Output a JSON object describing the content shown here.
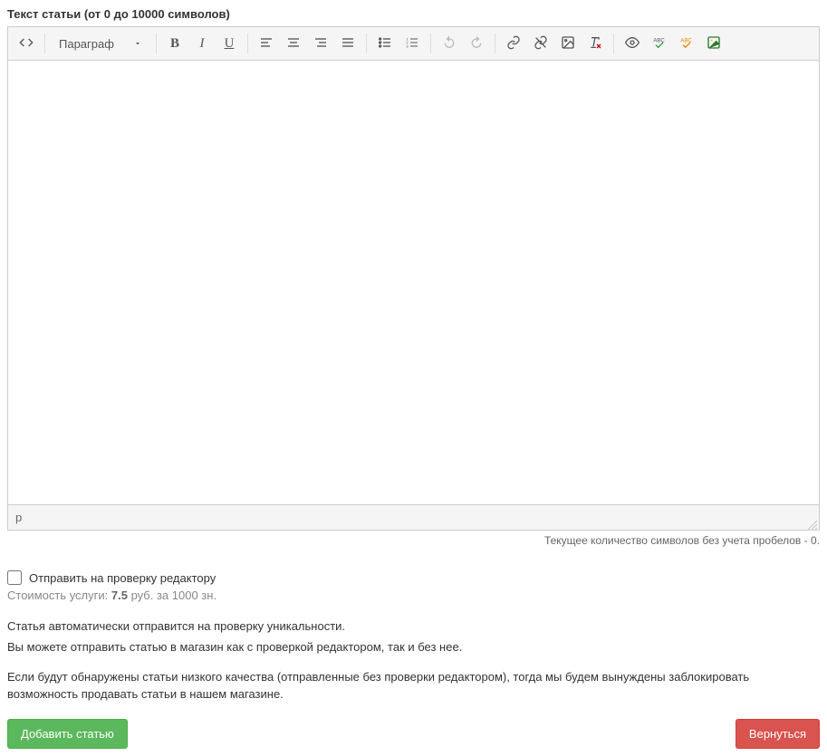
{
  "label": "Текст статьи (от 0 до 10000 символов)",
  "toolbar": {
    "format_label": "Параграф"
  },
  "status_path": "p",
  "char_count_prefix": "Текущее количество символов без учета пробелов - ",
  "char_count_value": "0",
  "char_count_suffix": ".",
  "checkbox": {
    "label": "Отправить на проверку редактору",
    "checked": false
  },
  "cost": {
    "prefix": "Стоимость услуги: ",
    "price": "7.5",
    "suffix": " руб. за 1000 зн."
  },
  "info": {
    "line1": "Статья автоматически отправится на проверку уникальности.",
    "line2": "Вы можете отправить статью в магазин как с проверкой редактором, так и без нее."
  },
  "warning": "Если будут обнаружены статьи низкого качества (отправленные без проверки редактором), тогда мы будем вынуждены заблокировать возможность продавать статьи в нашем магазине.",
  "buttons": {
    "submit": "Добавить статью",
    "back": "Вернуться"
  }
}
